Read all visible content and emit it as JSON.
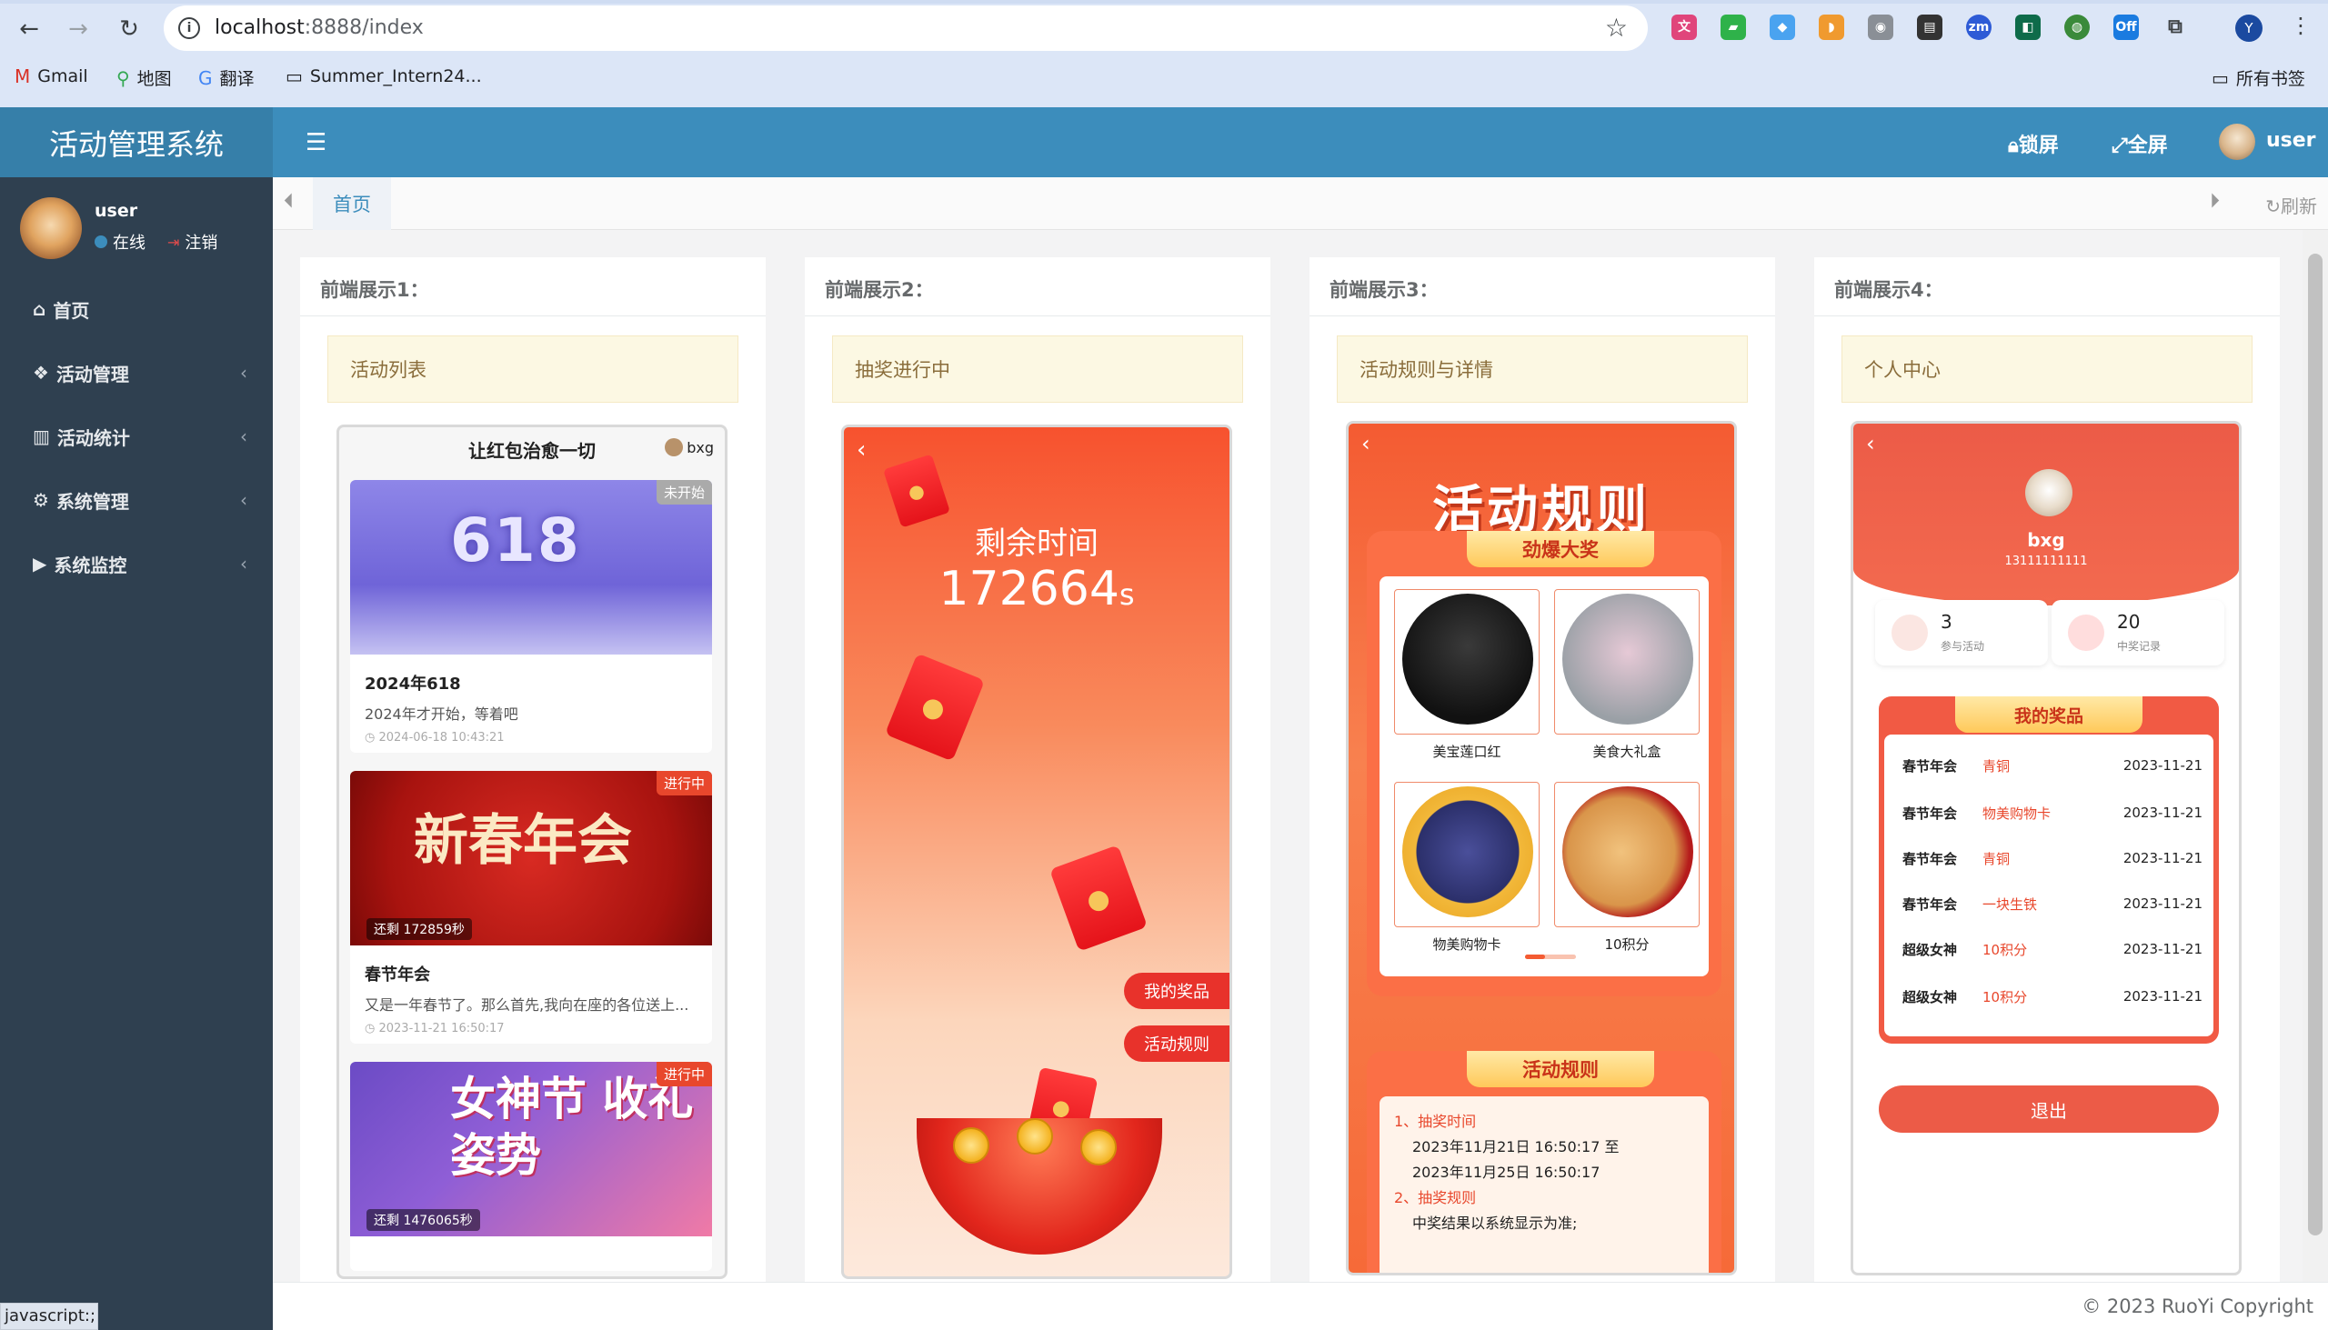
{
  "browser": {
    "url_host": "localhost",
    "url_rest": ":8888/index",
    "bookmarks": [
      "Gmail",
      "地图",
      "翻译",
      "Summer_Intern24...",
      "所有书签"
    ],
    "profile_initial": "Y",
    "status_url": "javascript:;"
  },
  "header": {
    "brand": "活动管理系统",
    "lock": "锁屏",
    "fullscreen": "全屏",
    "user": "user"
  },
  "sidebar": {
    "user": "user",
    "online": "在线",
    "logout": "注销",
    "items": [
      {
        "label": "首页",
        "icon": "home-icon"
      },
      {
        "label": "活动管理",
        "icon": "cubes-icon"
      },
      {
        "label": "活动统计",
        "icon": "bar-chart-icon"
      },
      {
        "label": "系统管理",
        "icon": "gear-icon"
      },
      {
        "label": "系统监控",
        "icon": "video-icon"
      }
    ]
  },
  "tabs": {
    "home": "首页",
    "refresh": "刷新"
  },
  "footer": "© 2023 RuoYi Copyright",
  "panels": [
    {
      "title": "前端展示1：",
      "tag": "活动列表"
    },
    {
      "title": "前端展示2：",
      "tag": "抽奖进行中"
    },
    {
      "title": "前端展示3：",
      "tag": "活动规则与详情"
    },
    {
      "title": "前端展示4：",
      "tag": "个人中心"
    }
  ],
  "phone1": {
    "title": "让红包治愈一切",
    "user": "bxg",
    "cards": [
      {
        "badge": "未开始",
        "badge_color": "#aaaaaa",
        "name": "2024年618",
        "desc": "2024年才开始，等着吧",
        "time": "2024-06-18 10:43:21",
        "img_text": "618",
        "count": ""
      },
      {
        "badge": "进行中",
        "badge_color": "#e8472c",
        "name": "春节年会",
        "desc": "又是一年春节了。那么首先,我向在座的各位送上...",
        "time": "2023-11-21 16:50:17",
        "img_text": "新春年会",
        "count": "还剩 172859秒"
      },
      {
        "badge": "进行中",
        "badge_color": "#e8472c",
        "name": "",
        "desc": "",
        "time": "",
        "img_text": "女神节 收礼姿势",
        "count": "还剩 1476065秒"
      }
    ]
  },
  "phone2": {
    "label": "剩余时间",
    "seconds": "172664",
    "unit": "s",
    "btn_prizes": "我的奖品",
    "btn_rules": "活动规则"
  },
  "phone3": {
    "title": "活动规则",
    "prize_header": "劲爆大奖",
    "prizes": [
      "美宝莲口红",
      "美食大礼盒",
      "物美购物卡",
      "10积分"
    ],
    "rules_header": "活动规则",
    "rule1_title": "1、抽奖时间",
    "rule1_from": "2023年11月21日 16:50:17 至",
    "rule1_to": "2023年11月25日 16:50:17",
    "rule2_title": "2、抽奖规则",
    "rule2_text": "中奖结果以系统显示为准;"
  },
  "phone4": {
    "name": "bxg",
    "phone": "13111111111",
    "joined": "3",
    "joined_label": "参与活动",
    "wins": "20",
    "wins_label": "中奖记录",
    "my_prizes": "我的奖品",
    "rows": [
      {
        "event": "春节年会",
        "prize": "青铜",
        "date": "2023-11-21"
      },
      {
        "event": "春节年会",
        "prize": "物美购物卡",
        "date": "2023-11-21"
      },
      {
        "event": "春节年会",
        "prize": "青铜",
        "date": "2023-11-21"
      },
      {
        "event": "春节年会",
        "prize": "一块生铁",
        "date": "2023-11-21"
      },
      {
        "event": "超级女神",
        "prize": "10积分",
        "date": "2023-11-21"
      },
      {
        "event": "超级女神",
        "prize": "10积分",
        "date": "2023-11-21"
      }
    ],
    "exit": "退出"
  }
}
